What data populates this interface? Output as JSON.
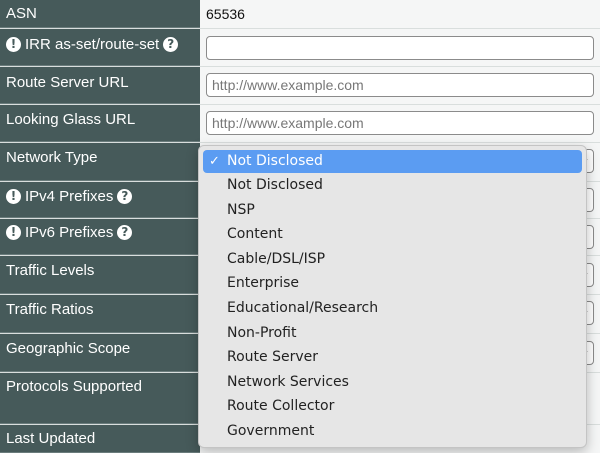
{
  "rows": {
    "asn": {
      "label": "ASN",
      "value": "65536"
    },
    "irr": {
      "label": "IRR as-set/route-set",
      "value": ""
    },
    "rs_url": {
      "label": "Route Server URL",
      "placeholder": "http://www.example.com"
    },
    "lg_url": {
      "label": "Looking Glass URL",
      "placeholder": "http://www.example.com"
    },
    "network_type": {
      "label": "Network Type"
    },
    "ipv4": {
      "label": "IPv4 Prefixes"
    },
    "ipv6": {
      "label": "IPv6 Prefixes"
    },
    "traffic_levels": {
      "label": "Traffic Levels"
    },
    "traffic_ratios": {
      "label": "Traffic Ratios"
    },
    "geo_scope": {
      "label": "Geographic Scope"
    },
    "protocols": {
      "label": "Protocols Supported"
    },
    "last_updated": {
      "label": "Last Updated"
    }
  },
  "dropdown": {
    "selected": "Not Disclosed",
    "check_glyph": "✓",
    "options": [
      "Not Disclosed",
      "NSP",
      "Content",
      "Cable/DSL/ISP",
      "Enterprise",
      "Educational/Research",
      "Non-Profit",
      "Route Server",
      "Network Services",
      "Route Collector",
      "Government"
    ]
  },
  "colors": {
    "label_bg": "#465a5a",
    "value_bg": "#f5f6f6",
    "selected_bg": "#5b9cf2"
  },
  "icons": {
    "info": "info-circle-icon",
    "chevron": "chevron-down-icon"
  }
}
